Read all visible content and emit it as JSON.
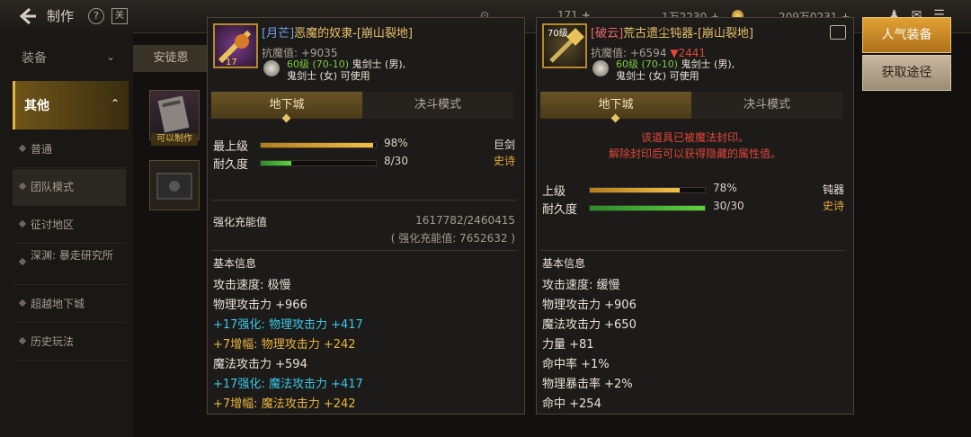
{
  "header": {
    "title": "制作",
    "help_symbol": "?",
    "calc_symbol": "关",
    "currency_a": "171",
    "currency_b": "1万2230",
    "currency_c": "209万0231",
    "plus": "+"
  },
  "sidebar": {
    "equip_label": "装备",
    "other_label": "其他",
    "items": [
      "普通",
      "团队模式",
      "征讨地区",
      "深渊: 暴走研究所",
      "超越地下城",
      "历史玩法"
    ]
  },
  "mid": {
    "tab_label": "安徒恩",
    "craftable_tag": "可以制作"
  },
  "right_buttons": {
    "popular": "人气装备",
    "obtain": "获取途径"
  },
  "panel_a": {
    "tag": "[月芒]",
    "name": "恶魔的奴隶-[崩山裂地]",
    "resist": "抗魔值: +9035",
    "level": "60级 (70-10)",
    "req_male": "鬼剑士 (男),",
    "req_female": "鬼剑士 (女) 可使用",
    "icon_level": "17",
    "tab_dungeon": "地下城",
    "tab_duel": "决斗模式",
    "grade_label": "最上级",
    "grade_value": "98%",
    "grade_pct": 98,
    "durability_label": "耐久度",
    "durability_value": "8/30",
    "durability_pct": 26.7,
    "weapon_type": "巨剑",
    "rarity": "史诗",
    "charge_label": "强化充能值",
    "charge_value": "1617782/2460415",
    "charge_sub": "( 强化充能值: 7652632 )",
    "basic_label": "基本信息",
    "lines": [
      {
        "text": "攻击速度: 极慢",
        "style": "white"
      },
      {
        "text": "物理攻击力 +966",
        "style": "white"
      },
      {
        "prefix": "+17强化: ",
        "text": "物理攻击力 +417",
        "style": "cyan"
      },
      {
        "prefix": " +7增幅: ",
        "text": "物理攻击力 +242",
        "style": "gold"
      },
      {
        "text": "魔法攻击力 +594",
        "style": "white"
      },
      {
        "prefix": "+17强化: ",
        "text": "魔法攻击力 +417",
        "style": "cyan"
      },
      {
        "prefix": " +7增幅: ",
        "text": "魔法攻击力 +242",
        "style": "gold"
      }
    ]
  },
  "panel_b": {
    "tag": "[破云]",
    "name": "荒古遗尘钝器-[崩山裂地]",
    "resist": "抗魔值: +6594",
    "resist_down": "▼2441",
    "level": "60级 (70-10)",
    "req_male": "鬼剑士 (男),",
    "req_female": "鬼剑士 (女) 可使用",
    "icon_level": "70级",
    "tab_dungeon": "地下城",
    "tab_duel": "决斗模式",
    "seal_1": "该道具已被魔法封印。",
    "seal_2": "解除封印后可以获得隐藏的属性值。",
    "grade_label": "上级",
    "grade_value": "78%",
    "grade_pct": 78,
    "durability_label": "耐久度",
    "durability_value": "30/30",
    "durability_pct": 100,
    "weapon_type": "钝器",
    "rarity": "史诗",
    "basic_label": "基本信息",
    "lines": [
      {
        "text": "攻击速度: 缓慢",
        "style": "white"
      },
      {
        "text": "物理攻击力 +906",
        "style": "white"
      },
      {
        "text": "魔法攻击力 +650",
        "style": "white"
      },
      {
        "text": "力量 +81",
        "style": "white"
      },
      {
        "text": "命中率 +1%",
        "style": "white"
      },
      {
        "text": "物理暴击率 +2%",
        "style": "white"
      },
      {
        "text": "命中 +254",
        "style": "white"
      }
    ]
  }
}
